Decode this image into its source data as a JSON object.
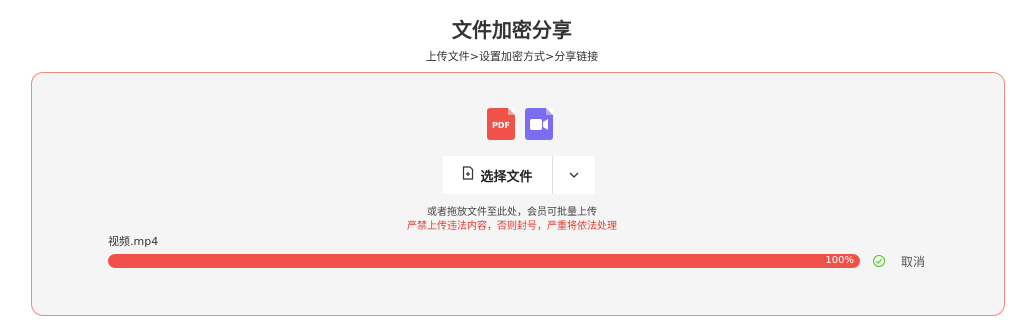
{
  "header": {
    "title": "文件加密分享",
    "breadcrumb": "上传文件>设置加密方式>分享链接"
  },
  "upload": {
    "file_type_icons": [
      {
        "name": "pdf-icon",
        "label": "PDF",
        "color": "#f0524a"
      },
      {
        "name": "video-icon",
        "color": "#7b6cf0"
      }
    ],
    "select_button_label": "选择文件",
    "hint": "或者拖放文件至此处，会员可批量上传",
    "warning": "严禁上传违法内容，否则封号，严重将依法处理",
    "border_color": "#f08a7e"
  },
  "file": {
    "name": "视频.mp4",
    "progress": 1.0,
    "progress_label": "100%",
    "status": "complete",
    "cancel_label": "取消"
  },
  "colors": {
    "accent": "#f0524a",
    "warning_text": "#e43b2f",
    "success": "#52c41a"
  }
}
